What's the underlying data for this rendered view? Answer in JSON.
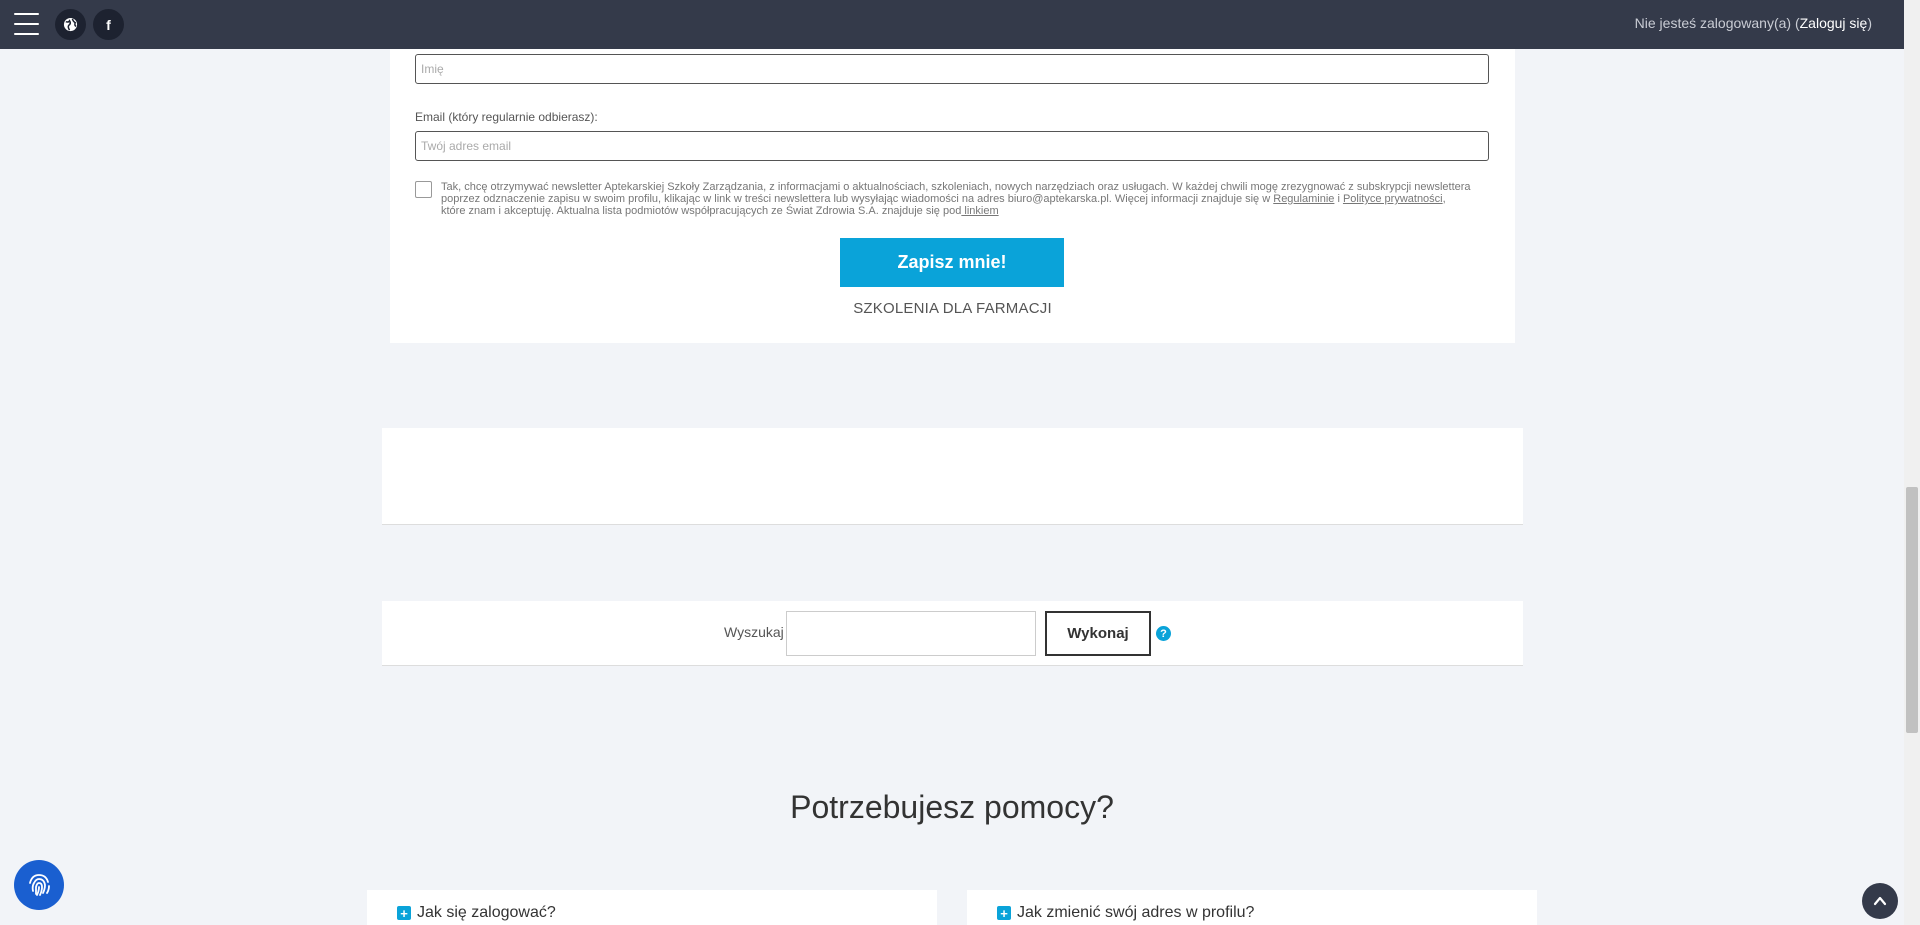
{
  "header": {
    "login_status_prefix": "Nie jesteś zalogowany(a) (",
    "login_link": "Zaloguj się",
    "login_status_suffix": ")"
  },
  "newsletter": {
    "name_placeholder": "Imię",
    "email_label": "Email (który regularnie odbierasz):",
    "email_placeholder": "Twój adres email",
    "consent_part1": "Tak, chcę otrzymywać newsletter Aptekarskiej Szkoły Zarządzania, z informacjami o aktualnościach, szkoleniach, nowych narzędziach oraz usługach. W każdej chwili mogę zrezygnować z subskrypcji newslettera poprzez odznaczenie zapisu w swoim profilu, klikając w link w treści newslettera lub wysyłając wiadomości na adres biuro@aptekarska.pl. Więcej informacji znajduje się w ",
    "consent_link_regulamin": "Regulaminie",
    "consent_part2": " i ",
    "consent_link_polityka": "Polityce prywatności",
    "consent_part3": ", które znam i akceptuję. Aktualna lista podmiotów współpracujących ze Świat Zdrowia S.A. znajduje się pod",
    "consent_link_linkiem": " linkiem",
    "submit_label": "Zapisz mnie!",
    "trainings_link": "SZKOLENIA DLA FARMACJI"
  },
  "search": {
    "label": "Wyszukaj",
    "button": "Wykonaj",
    "help_icon": "?"
  },
  "help": {
    "title": "Potrzebujesz pomocy?",
    "faq": [
      {
        "question": "Jak się zalogować?"
      },
      {
        "question": "Jak zmienić swój adres w profilu?"
      }
    ]
  },
  "colors": {
    "topbar": "#343a4a",
    "accent": "#0aa3d9",
    "fingerprint": "#1a5fd0"
  }
}
